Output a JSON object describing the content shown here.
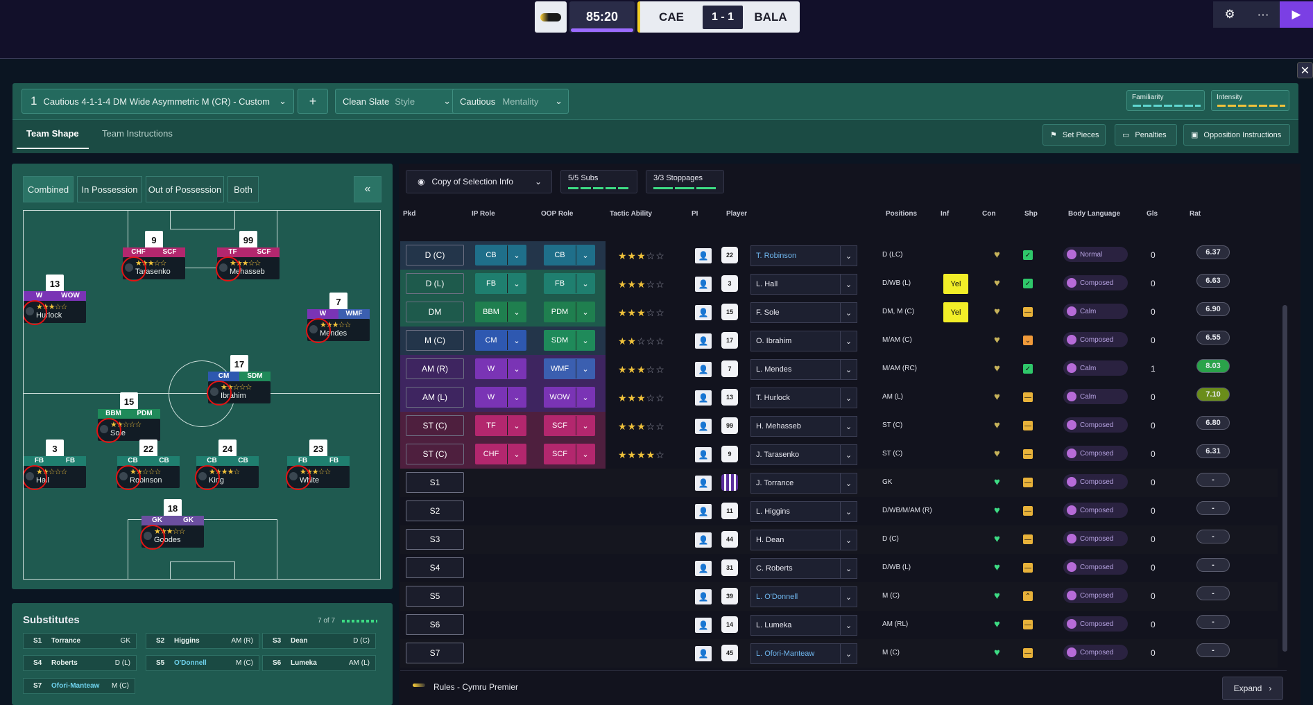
{
  "scoreboard": {
    "time": "85:20",
    "home": "CAE",
    "score": "1 - 1",
    "away": "BALA"
  },
  "tactic": {
    "slot": "1",
    "name": "Cautious 4-1-1-4 DM Wide Asymmetric M (CR) - Custom",
    "style_value": "Clean Slate",
    "style_label": "Style",
    "mentality_value": "Cautious",
    "mentality_label": "Mentality",
    "familiarity": "Familiarity",
    "intensity": "Intensity"
  },
  "tabs": {
    "shape": "Team Shape",
    "instructions": "Team Instructions"
  },
  "right_buttons": {
    "set_pieces": "Set Pieces",
    "penalties": "Penalties",
    "opposition": "Opposition Instructions"
  },
  "pitch_tabs": [
    "Combined",
    "In Possession",
    "Out of Possession",
    "Both"
  ],
  "pitch_players": [
    {
      "num": "9",
      "r1": "CHF",
      "r2": "SCF",
      "name": "Tarasenko",
      "stars": "★★★☆☆"
    },
    {
      "num": "99",
      "r1": "TF",
      "r2": "SCF",
      "name": "Mehasseb",
      "stars": "★★★☆☆"
    },
    {
      "num": "13",
      "r1": "W",
      "r2": "WOW",
      "name": "Hurlock",
      "stars": "★★★☆☆"
    },
    {
      "num": "7",
      "r1": "W",
      "r2": "WMF",
      "name": "Mendes",
      "stars": "★★★☆☆"
    },
    {
      "num": "17",
      "r1": "CM",
      "r2": "SDM",
      "name": "Ibrahim",
      "stars": "★★☆☆☆"
    },
    {
      "num": "15",
      "r1": "BBM",
      "r2": "PDM",
      "name": "Sole",
      "stars": "★★☆☆☆"
    },
    {
      "num": "3",
      "r1": "FB",
      "r2": "FB",
      "name": "Hall",
      "stars": "★★☆☆☆"
    },
    {
      "num": "22",
      "r1": "CB",
      "r2": "CB",
      "name": "Robinson",
      "stars": "★★☆☆☆"
    },
    {
      "num": "24",
      "r1": "CB",
      "r2": "CB",
      "name": "King",
      "stars": "★★★★☆"
    },
    {
      "num": "23",
      "r1": "FB",
      "r2": "FB",
      "name": "White",
      "stars": "★★★☆☆"
    },
    {
      "num": "18",
      "r1": "GK",
      "r2": "GK",
      "name": "Goodes",
      "stars": "★★★☆☆"
    }
  ],
  "substitutes": {
    "title": "Substitutes",
    "count": "7 of 7",
    "list": [
      {
        "slot": "S1",
        "name": "Torrance",
        "pos": "GK"
      },
      {
        "slot": "S2",
        "name": "Higgins",
        "pos": "AM (R)"
      },
      {
        "slot": "S3",
        "name": "Dean",
        "pos": "D (C)"
      },
      {
        "slot": "S4",
        "name": "Roberts",
        "pos": "D (L)"
      },
      {
        "slot": "S5",
        "name": "O'Donnell",
        "pos": "M (C)"
      },
      {
        "slot": "S6",
        "name": "Lumeka",
        "pos": "AM (L)"
      },
      {
        "slot": "S7",
        "name": "Ofori-Manteaw",
        "pos": "M (C)"
      }
    ]
  },
  "selection": {
    "view": "Copy of Selection Info",
    "subs": "5/5 Subs",
    "stoppages": "3/3 Stoppages"
  },
  "columns": [
    "Pkd",
    "IP Role",
    "OOP Role",
    "Tactic Ability",
    "PI",
    "Player",
    "Positions",
    "Inf",
    "Con",
    "Shp",
    "Body Language",
    "Gls",
    "Rat"
  ],
  "rows": [
    {
      "pkd": "D (C)",
      "ip": "CB",
      "oop": "CB",
      "stars": "★★★",
      "off": "☆☆",
      "num": "22",
      "player": "T. Robinson",
      "pos": "D (LC)",
      "inf": "",
      "shp": "check",
      "bl": "Normal",
      "gls": "0",
      "rat": "6.37",
      "col": "#23354a"
    },
    {
      "pkd": "D (L)",
      "ip": "FB",
      "oop": "FB",
      "stars": "★★★",
      "off": "☆☆",
      "num": "3",
      "player": "L. Hall",
      "pos": "D/WB (L)",
      "inf": "Yel",
      "shp": "check",
      "bl": "Composed",
      "gls": "0",
      "rat": "6.63",
      "col": "#1e5a4c"
    },
    {
      "pkd": "DM",
      "ip": "BBM",
      "oop": "PDM",
      "stars": "★★★",
      "off": "☆☆",
      "num": "15",
      "player": "F. Sole",
      "pos": "DM, M (C)",
      "inf": "Yel",
      "shp": "dash",
      "bl": "Calm",
      "gls": "0",
      "rat": "6.90",
      "col": "#1e5a4c"
    },
    {
      "pkd": "M (C)",
      "ip": "CM",
      "oop": "SDM",
      "stars": "★★",
      "off": "☆☆☆",
      "num": "17",
      "player": "O. Ibrahim",
      "pos": "M/AM (C)",
      "inf": "",
      "shp": "down",
      "bl": "Composed",
      "gls": "0",
      "rat": "6.55",
      "col": "#23354a"
    },
    {
      "pkd": "AM (R)",
      "ip": "W",
      "oop": "WMF",
      "stars": "★★★",
      "off": "☆☆",
      "num": "7",
      "player": "L. Mendes",
      "pos": "M/AM (RC)",
      "inf": "",
      "shp": "check",
      "bl": "Calm",
      "gls": "1",
      "rat": "8.03",
      "col": "#3e2560"
    },
    {
      "pkd": "AM (L)",
      "ip": "W",
      "oop": "WOW",
      "stars": "★★★",
      "off": "☆☆",
      "num": "13",
      "player": "T. Hurlock",
      "pos": "AM (L)",
      "inf": "",
      "shp": "dash",
      "bl": "Calm",
      "gls": "0",
      "rat": "7.10",
      "col": "#3e2560"
    },
    {
      "pkd": "ST (C)",
      "ip": "TF",
      "oop": "SCF",
      "stars": "★★★",
      "off": "☆☆",
      "num": "99",
      "player": "H. Mehasseb",
      "pos": "ST (C)",
      "inf": "",
      "shp": "dash",
      "bl": "Composed",
      "gls": "0",
      "rat": "6.80",
      "col": "#4e1f3e"
    },
    {
      "pkd": "ST (C)",
      "ip": "CHF",
      "oop": "SCF",
      "stars": "★★★★",
      "off": "☆",
      "num": "9",
      "player": "J. Tarasenko",
      "pos": "ST (C)",
      "inf": "",
      "shp": "dash",
      "bl": "Composed",
      "gls": "0",
      "rat": "6.31",
      "col": "#4e1f3e"
    },
    {
      "pkd": "S1",
      "player": "J. Torrance",
      "num": "",
      "pos": "GK",
      "shp": "dash",
      "bl": "Composed",
      "gls": "0",
      "rat": "-"
    },
    {
      "pkd": "S2",
      "player": "L. Higgins",
      "num": "11",
      "pos": "D/WB/M/AM (R)",
      "shp": "dash",
      "bl": "Composed",
      "gls": "0",
      "rat": "-"
    },
    {
      "pkd": "S3",
      "player": "H. Dean",
      "num": "44",
      "pos": "D (C)",
      "shp": "dash",
      "bl": "Composed",
      "gls": "0",
      "rat": "-"
    },
    {
      "pkd": "S4",
      "player": "C. Roberts",
      "num": "31",
      "pos": "D/WB (L)",
      "shp": "dash",
      "bl": "Composed",
      "gls": "0",
      "rat": "-"
    },
    {
      "pkd": "S5",
      "player": "L. O'Donnell",
      "num": "39",
      "pos": "M (C)",
      "shp": "up",
      "bl": "Composed",
      "gls": "0",
      "rat": "-"
    },
    {
      "pkd": "S6",
      "player": "L. Lumeka",
      "num": "14",
      "pos": "AM (RL)",
      "shp": "dash",
      "bl": "Composed",
      "gls": "0",
      "rat": "-"
    },
    {
      "pkd": "S7",
      "player": "L. Ofori-Manteaw",
      "num": "45",
      "pos": "M (C)",
      "shp": "dash",
      "bl": "Composed",
      "gls": "0",
      "rat": "-"
    }
  ],
  "footer": {
    "rules": "Rules - Cymru Premier",
    "expand": "Expand"
  }
}
